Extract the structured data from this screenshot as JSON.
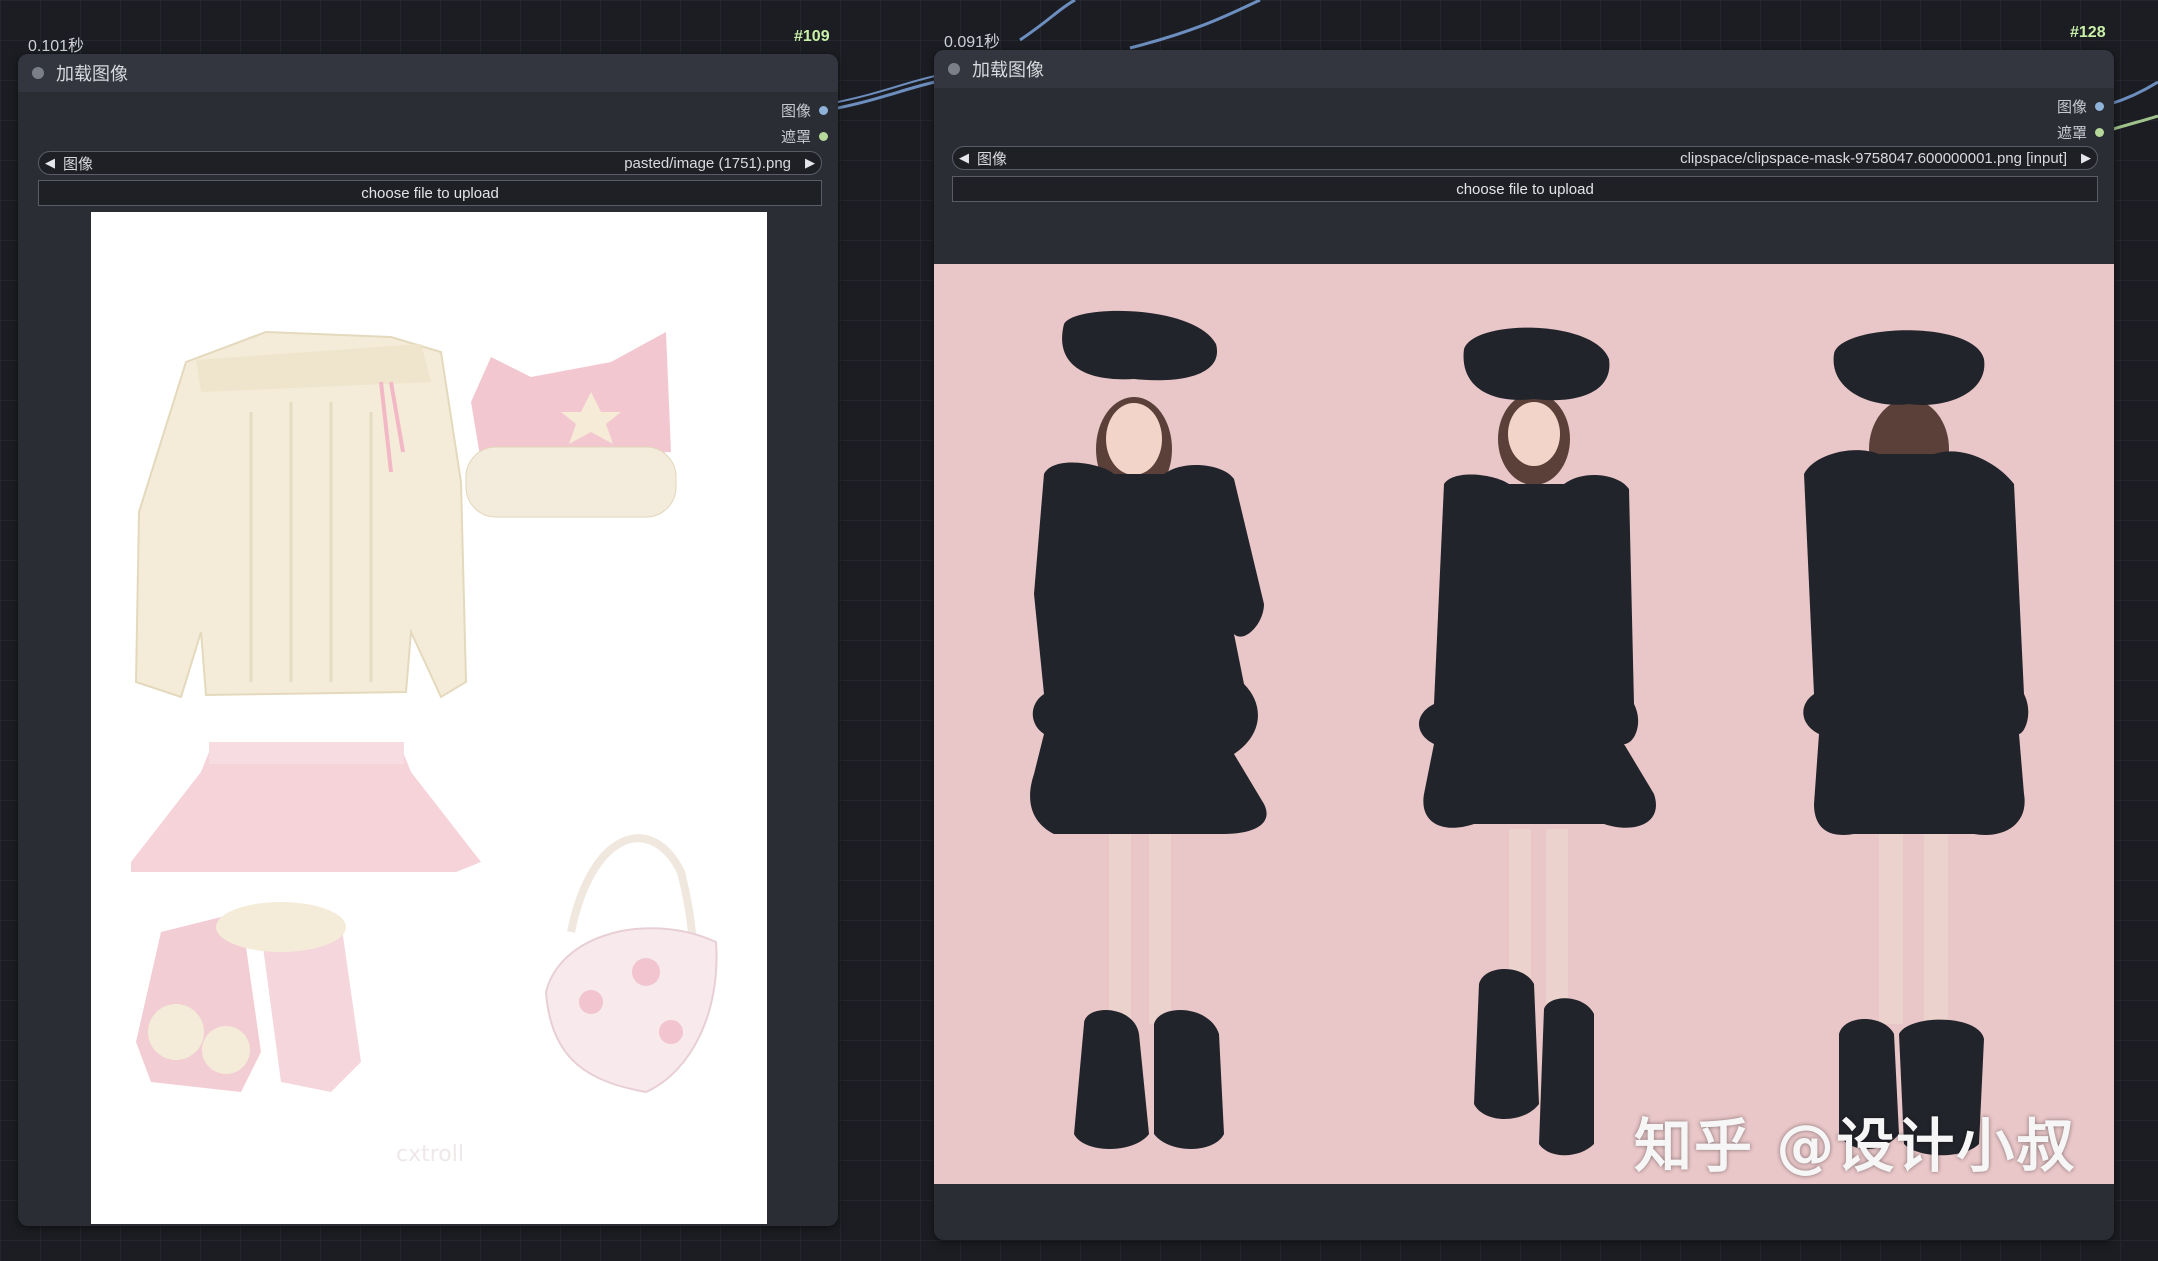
{
  "nodes": [
    {
      "id": "#109",
      "timing": "0.101秒",
      "title": "加载图像",
      "outputs": [
        "图像",
        "遮罩"
      ],
      "widget_label": "图像",
      "widget_value": "pasted/image (1751).png",
      "upload_label": "choose file to upload",
      "preview_text": "cxtroll"
    },
    {
      "id": "#128",
      "timing": "0.091秒",
      "title": "加载图像",
      "outputs": [
        "图像",
        "遮罩"
      ],
      "widget_label": "图像",
      "widget_value": "clipspace/clipspace-mask-9758047.600000001.png [input]",
      "upload_label": "choose file to upload"
    }
  ],
  "watermark": "知乎 @设计小叔",
  "icons": {
    "prev": "triangle-left-icon",
    "next": "triangle-right-icon"
  },
  "colors": {
    "canvas": "#1b1d22",
    "node_body": "#2a2d34",
    "node_header": "#33363e",
    "id_badge": "#c9f0a8",
    "port_image": "#8fb2d9",
    "port_mask": "#b6d89a",
    "mask_fill": "#22242b",
    "photo_bg": "#e9c6c8"
  }
}
